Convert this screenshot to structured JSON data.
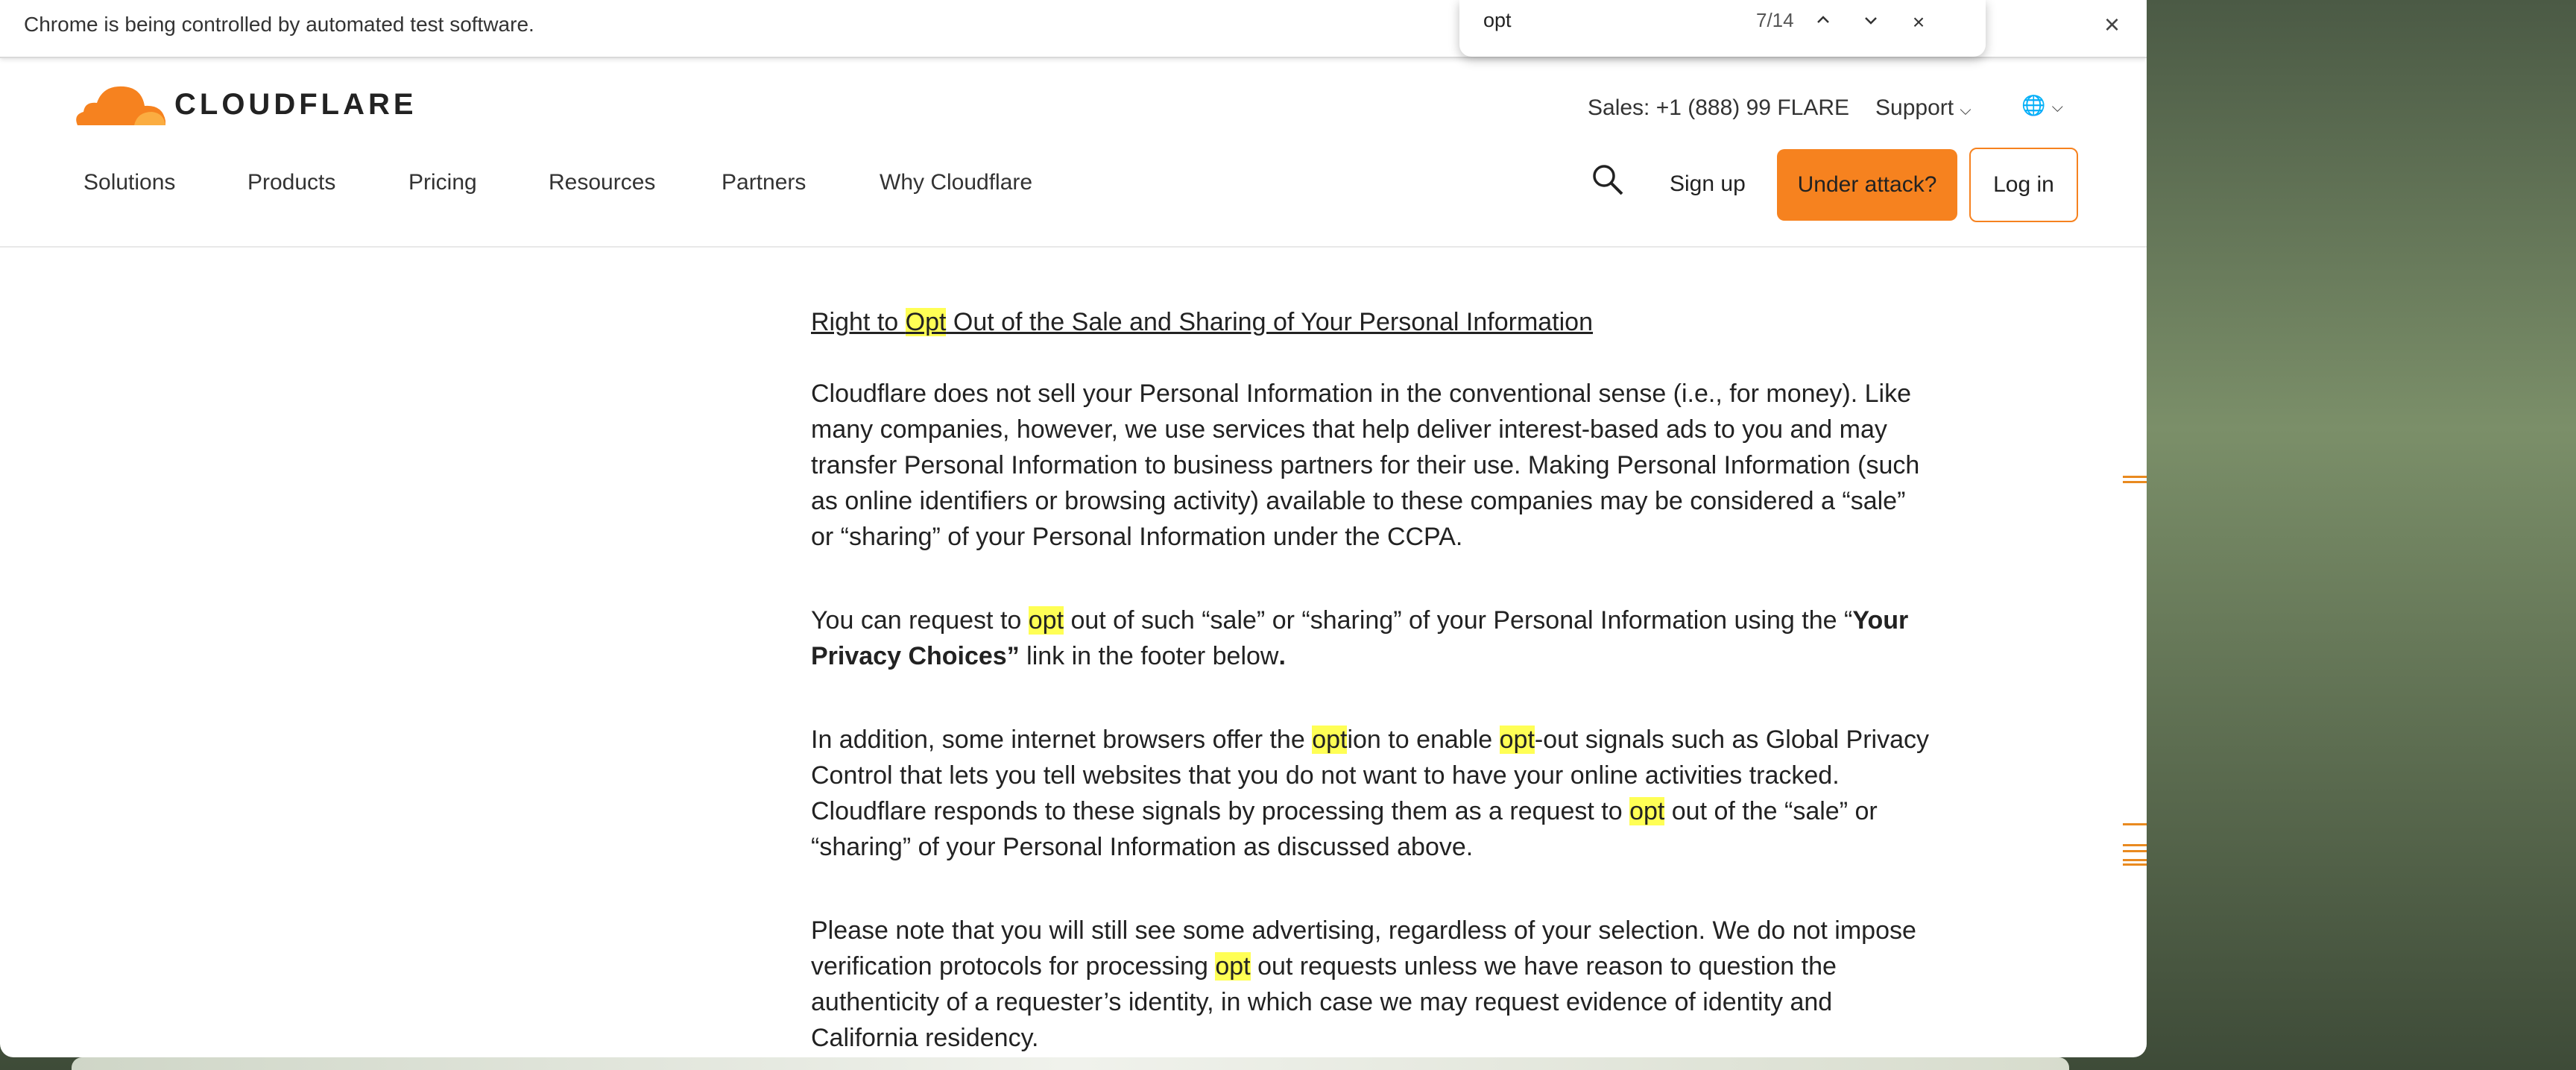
{
  "infobar": {
    "message": "Chrome is being controlled by automated test software.",
    "close": "×"
  },
  "findbar": {
    "query": "opt",
    "count": "7/14",
    "prev": "⌃",
    "next": "⌄",
    "close": "×"
  },
  "header": {
    "logo_text": "CLOUDFLARE",
    "sales": "Sales: +1 (888) 99 FLARE",
    "support": "Support",
    "globe": "🌐",
    "nav": [
      "Solutions",
      "Products",
      "Pricing",
      "Resources",
      "Partners",
      "Why Cloudflare"
    ],
    "signup": "Sign up",
    "attack": "Under attack?",
    "login": "Log in",
    "brand_color": "#f6821f"
  },
  "content": {
    "section_title_pre": "Right to ",
    "section_title_hl": "Opt",
    "section_title_post": " Out of the Sale and Sharing of Your Personal Information",
    "p1": "Cloudflare does not sell your Personal Information in the conventional sense (i.e., for money). Like many companies, however, we use services that help deliver interest-based ads to you and may transfer Personal Information to business partners for their use. Making Personal Information (such as online identifiers or browsing activity) available to these companies may be considered a “sale” or “sharing” of your Personal Information under the CCPA.",
    "p2_a": "You can request to ",
    "p2_hl": "opt",
    "p2_b": " out of such “sale” or “sharing” of your Personal Information using the “",
    "p2_bold": "Your Privacy Choices”",
    "p2_c": " link in the footer below",
    "p2_d": ".",
    "p3_a": "In addition, some internet browsers offer the ",
    "p3_hl1": "opt",
    "p3_b": "ion to enable ",
    "p3_hl2": "opt",
    "p3_c": "-out signals such as Global Privacy Control that lets you tell websites that you do not want to have your online activities tracked. Cloudflare responds to these signals by processing them as a request to ",
    "p3_hl3": "opt",
    "p3_d": " out of the “sale” or “sharing” of your Personal Information as discussed above.",
    "p4_a": "Please note that you will still see some advertising, regardless of your selection. We do not impose verification protocols for processing ",
    "p4_hl": "opt",
    "p4_b": " out requests unless we have reason to question the authenticity of a requester’s identity, in which case we may request evidence of identity and California residency."
  },
  "highlight_color": "#ffff55"
}
